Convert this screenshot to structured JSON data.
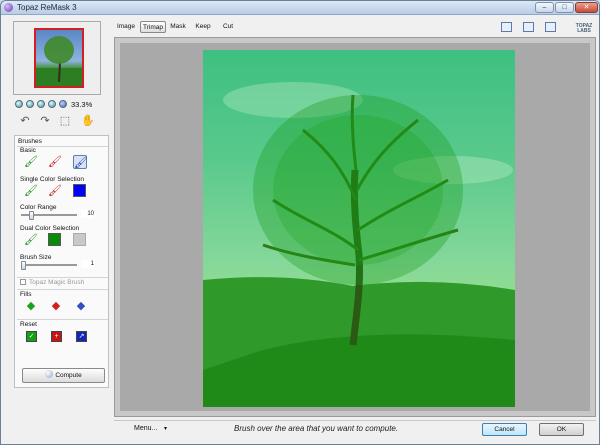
{
  "window": {
    "title": "Topaz ReMask 3",
    "minimize": "–",
    "maximize": "□",
    "close": "✕"
  },
  "preview": {
    "zoom": "33.3%"
  },
  "tabs": [
    {
      "label": "Image",
      "active": false
    },
    {
      "label": "Trimap",
      "active": true
    },
    {
      "label": "Mask",
      "active": false
    },
    {
      "label": "Keep",
      "active": false
    },
    {
      "label": "Cut",
      "active": false
    }
  ],
  "brand": {
    "logo_text": "TOPAZ LABS"
  },
  "panel": {
    "header": "Brushes",
    "basic_label": "Basic",
    "single_color_label": "Single Color Selection",
    "single_color_swatch": "#0000ff",
    "color_range_label": "Color Range",
    "color_range_value": "10",
    "color_range_level": 0.15,
    "dual_color_label": "Dual Color Selection",
    "dual_color_swatch_1": "#0a8a0a",
    "dual_color_swatch_2": "#c8c8c8",
    "brush_size_label": "Brush Size",
    "brush_size_value": "1",
    "brush_size_level": 0.0,
    "magic_brush_label": "Topaz Magic Brush",
    "fills_label": "Fills",
    "reset_label": "Reset",
    "compute_label": "Compute"
  },
  "footer": {
    "menu_label": "Menu...",
    "menu_caret": "▾",
    "hint": "Brush over the area that you want to compute.",
    "cancel_label": "Cancel",
    "ok_label": "OK"
  },
  "icons": {
    "undo": "↶",
    "redo": "↷",
    "select": "⬚",
    "hand": "✋",
    "brush": "🖌",
    "fill_green": "◆",
    "fill_red": "◆",
    "fill_blue": "◆",
    "reset_green": "✓",
    "reset_red": "+",
    "reset_blue": "↗"
  },
  "colors": {
    "accent_blue": "#3c7fb1",
    "keep_green": "#00b800",
    "cut_red": "#d02020",
    "compute_blue": "#0000ff"
  }
}
